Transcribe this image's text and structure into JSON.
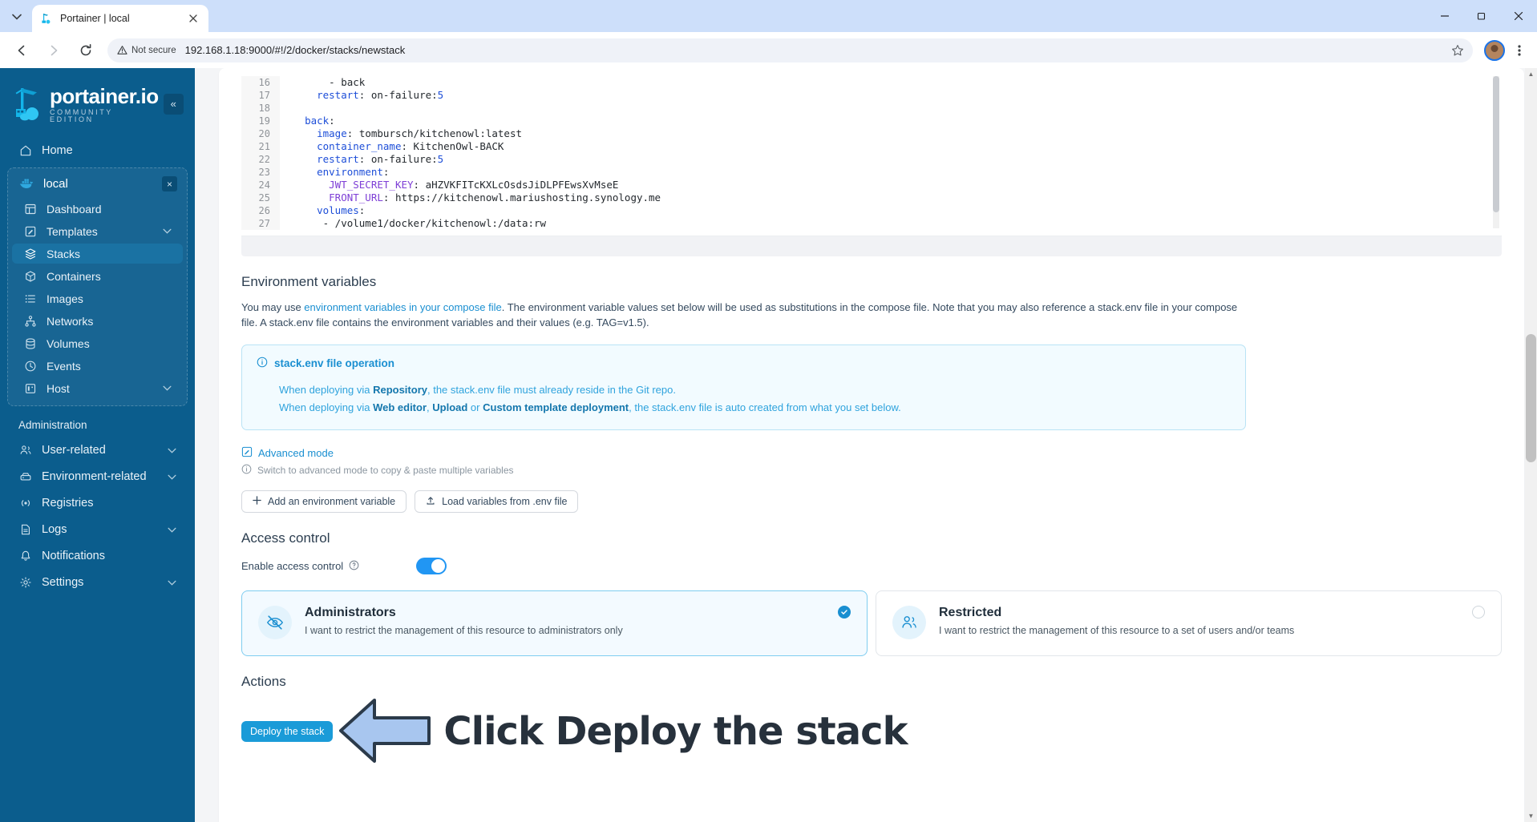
{
  "browser": {
    "tab_title": "Portainer | local",
    "security_label": "Not secure",
    "url": "192.168.1.18:9000/#!/2/docker/stacks/newstack",
    "tab_search_icon": "chevron-down-icon",
    "close_tab_icon": "close-icon",
    "back_icon": "arrow-left-icon",
    "forward_icon": "arrow-right-icon",
    "reload_icon": "reload-icon",
    "bookmark_icon": "star-icon",
    "menu_icon": "kebab-menu-icon",
    "minimize_icon": "minimize-icon",
    "maximize_icon": "maximize-icon",
    "window_close_icon": "close-icon"
  },
  "sidebar": {
    "logo_main": "portainer.io",
    "logo_sub": "COMMUNITY EDITION",
    "collapse_icon": "«",
    "home_label": "Home",
    "environment": {
      "name": "local",
      "close_icon": "×"
    },
    "env_items": [
      {
        "label": "Dashboard",
        "icon": "dashboard-icon",
        "chevron": false,
        "active": false
      },
      {
        "label": "Templates",
        "icon": "templates-icon",
        "chevron": true,
        "active": false
      },
      {
        "label": "Stacks",
        "icon": "stacks-icon",
        "chevron": false,
        "active": true
      },
      {
        "label": "Containers",
        "icon": "containers-icon",
        "chevron": false,
        "active": false
      },
      {
        "label": "Images",
        "icon": "images-icon",
        "chevron": false,
        "active": false
      },
      {
        "label": "Networks",
        "icon": "networks-icon",
        "chevron": false,
        "active": false
      },
      {
        "label": "Volumes",
        "icon": "volumes-icon",
        "chevron": false,
        "active": false
      },
      {
        "label": "Events",
        "icon": "events-icon",
        "chevron": false,
        "active": false
      },
      {
        "label": "Host",
        "icon": "host-icon",
        "chevron": true,
        "active": false
      }
    ],
    "administration_label": "Administration",
    "admin_items": [
      {
        "label": "User-related",
        "icon": "users-icon",
        "chevron": true
      },
      {
        "label": "Environment-related",
        "icon": "server-icon",
        "chevron": true
      },
      {
        "label": "Registries",
        "icon": "registries-icon",
        "chevron": false
      },
      {
        "label": "Logs",
        "icon": "logs-icon",
        "chevron": true
      },
      {
        "label": "Notifications",
        "icon": "bell-icon",
        "chevron": false
      },
      {
        "label": "Settings",
        "icon": "gear-icon",
        "chevron": true
      }
    ]
  },
  "editor": {
    "lines": [
      {
        "no": "16",
        "indent": 6,
        "text": "- back",
        "type": "plain"
      },
      {
        "no": "17",
        "indent": 4,
        "key": "restart",
        "value": "on-failure:",
        "num": "5"
      },
      {
        "no": "18",
        "indent": 0,
        "text": "",
        "type": "plain"
      },
      {
        "no": "19",
        "indent": 2,
        "key": "back",
        "value": "",
        "type": "mapkey"
      },
      {
        "no": "20",
        "indent": 4,
        "key": "image",
        "value": "tombursch/kitchenowl:latest"
      },
      {
        "no": "21",
        "indent": 4,
        "key": "container_name",
        "value": "KitchenOwl-BACK"
      },
      {
        "no": "22",
        "indent": 4,
        "key": "restart",
        "value": "on-failure:",
        "num": "5"
      },
      {
        "no": "23",
        "indent": 4,
        "key": "environment",
        "value": "",
        "type": "mapkey"
      },
      {
        "no": "24",
        "indent": 6,
        "key": "JWT_SECRET_KEY",
        "value": "aHZVKFITcKXLcOsdsJiDLPFEwsXvMseE",
        "purple": true
      },
      {
        "no": "25",
        "indent": 6,
        "key": "FRONT_URL",
        "value": "https://kitchenowl.mariushosting.synology.me",
        "purple": true
      },
      {
        "no": "26",
        "indent": 4,
        "key": "volumes",
        "value": "",
        "type": "mapkey"
      },
      {
        "no": "27",
        "indent": 5,
        "text": "- /volume1/docker/kitchenowl:/data:rw",
        "type": "plain"
      }
    ]
  },
  "env_section": {
    "title": "Environment variables",
    "desc_part1": "You may use ",
    "desc_link": "environment variables in your compose file",
    "desc_part2": ". The environment variable values set below will be used as substitutions in the compose file. Note that you may also reference a stack.env file in your compose file. A stack.env file contains the environment variables and their values (e.g. TAG=v1.5).",
    "info_title": "stack.env file operation",
    "info_icon": "info-circle-icon",
    "info_line1_a": "When deploying via ",
    "info_line1_b": "Repository",
    "info_line1_c": ", the stack.env file must already reside in the Git repo.",
    "info_line2_a": "When deploying via ",
    "info_line2_b": "Web editor",
    "info_line2_c": ", ",
    "info_line2_d": "Upload",
    "info_line2_e": " or ",
    "info_line2_f": "Custom template deployment",
    "info_line2_g": ", the stack.env file is auto created from what you set below.",
    "advanced_mode": "Advanced mode",
    "advanced_icon": "edit-square-icon",
    "advanced_hint": "Switch to advanced mode to copy & paste multiple variables",
    "advanced_hint_icon": "info-circle-icon",
    "add_variable_btn": "Add an environment variable",
    "add_variable_icon": "plus-icon",
    "load_env_btn": "Load variables from .env file",
    "load_env_icon": "upload-icon"
  },
  "access_control": {
    "title": "Access control",
    "toggle_label": "Enable access control",
    "toggle_help_icon": "question-circle-icon",
    "toggle_enabled": true,
    "options": [
      {
        "title": "Administrators",
        "desc": "I want to restrict the management of this resource to administrators only",
        "icon": "eye-off-icon",
        "selected": true,
        "check_icon": "check-icon"
      },
      {
        "title": "Restricted",
        "desc": "I want to restrict the management of this resource to a set of users and/or teams",
        "icon": "users-icon",
        "selected": false,
        "check_icon": ""
      }
    ]
  },
  "actions": {
    "title": "Actions",
    "deploy_button": "Deploy the stack"
  },
  "annotation": {
    "text": "Click Deploy the stack",
    "arrow_icon": "arrow-left-annotation",
    "arrow_fill": "#a8c6ef",
    "arrow_stroke": "#2b3a4a",
    "text_color": "#27313c"
  },
  "colors": {
    "sidebar_bg": "#0b5d8d",
    "accent": "#1a8fd1",
    "deploy_btn": "#1a9bd8",
    "active_nav": "#1a72a3"
  }
}
